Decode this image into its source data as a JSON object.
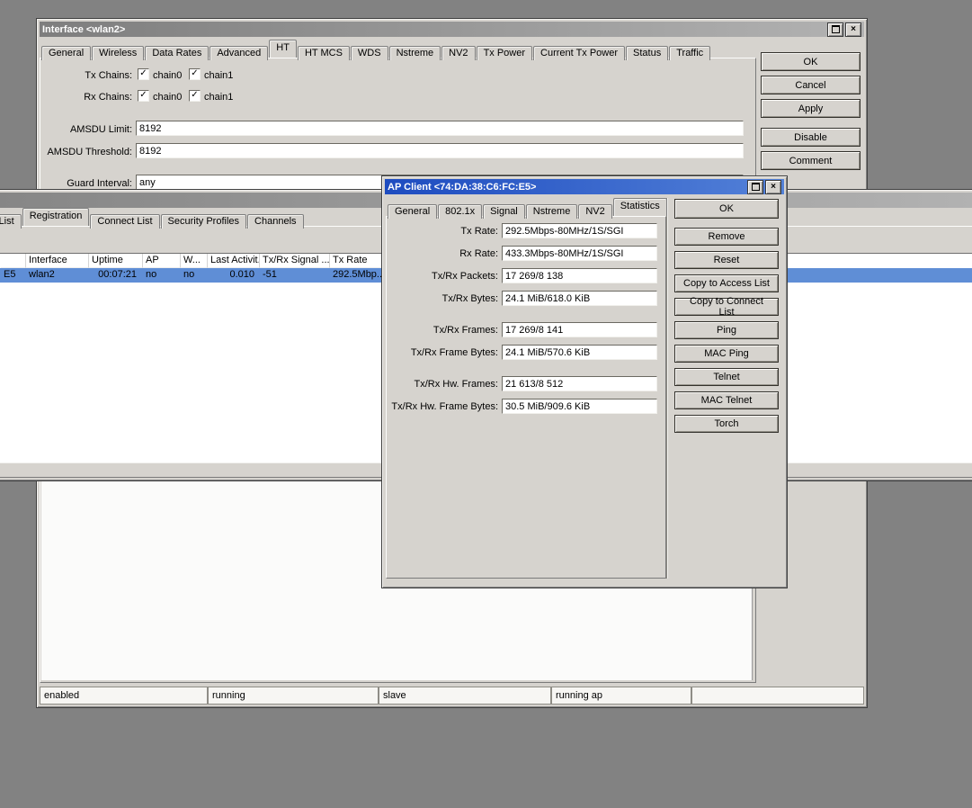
{
  "glyphs": {
    "check": "✓",
    "close": "×",
    "dropdown": "▼"
  },
  "colors": {
    "selection": "#5f8ed6",
    "active_title": "#1e4cc0",
    "desktop": "#828282"
  },
  "interface_window": {
    "title": "Interface <wlan2>",
    "tabs": [
      "General",
      "Wireless",
      "Data Rates",
      "Advanced",
      "HT",
      "HT MCS",
      "WDS",
      "Nstreme",
      "NV2",
      "Tx Power",
      "Current Tx Power",
      "Status",
      "Traffic"
    ],
    "active_tab": "HT",
    "form": {
      "tx_chains_label": "Tx Chains:",
      "rx_chains_label": "Rx Chains:",
      "chain0_label": "chain0",
      "chain1_label": "chain1",
      "amsdu_limit_label": "AMSDU Limit:",
      "amsdu_limit_value": "8192",
      "amsdu_threshold_label": "AMSDU Threshold:",
      "amsdu_threshold_value": "8192",
      "guard_interval_label": "Guard Interval:",
      "guard_interval_value": "any"
    },
    "side_buttons": [
      "OK",
      "Cancel",
      "Apply",
      "Disable",
      "Comment"
    ],
    "statusbar": [
      "enabled",
      "running",
      "slave",
      "running ap",
      ""
    ]
  },
  "wireless_window": {
    "tabs": [
      "s List",
      "Registration",
      "Connect List",
      "Security Profiles",
      "Channels"
    ],
    "active_tab": "Registration",
    "table": {
      "columns": [
        "",
        "Interface",
        "Uptime",
        "AP",
        "W...",
        "Last Activit...",
        "Tx/Rx Signal ...",
        "Tx Rate"
      ],
      "row": [
        "E5",
        "wlan2",
        "00:07:21",
        "no",
        "no",
        "0.010",
        "-51",
        "292.5Mbp..."
      ]
    }
  },
  "ap_client_window": {
    "title": "AP Client <74:DA:38:C6:FC:E5>",
    "tabs": [
      "General",
      "802.1x",
      "Signal",
      "Nstreme",
      "NV2",
      "Statistics"
    ],
    "active_tab": "Statistics",
    "fields": [
      {
        "label": "Tx Rate:",
        "value": "292.5Mbps-80MHz/1S/SGI"
      },
      {
        "label": "Rx Rate:",
        "value": "433.3Mbps-80MHz/1S/SGI"
      },
      {
        "label": "Tx/Rx Packets:",
        "value": "17 269/8 138"
      },
      {
        "label": "Tx/Rx Bytes:",
        "value": "24.1 MiB/618.0 KiB"
      },
      {
        "label": "Tx/Rx Frames:",
        "value": "17 269/8 141"
      },
      {
        "label": "Tx/Rx Frame Bytes:",
        "value": "24.1 MiB/570.6 KiB"
      },
      {
        "label": "Tx/Rx Hw. Frames:",
        "value": "21 613/8 512"
      },
      {
        "label": "Tx/Rx Hw. Frame Bytes:",
        "value": "30.5 MiB/909.6 KiB"
      }
    ],
    "buttons": [
      "OK",
      "Remove",
      "Reset",
      "Copy to Access List",
      "Copy to Connect List",
      "Ping",
      "MAC Ping",
      "Telnet",
      "MAC Telnet",
      "Torch"
    ]
  }
}
